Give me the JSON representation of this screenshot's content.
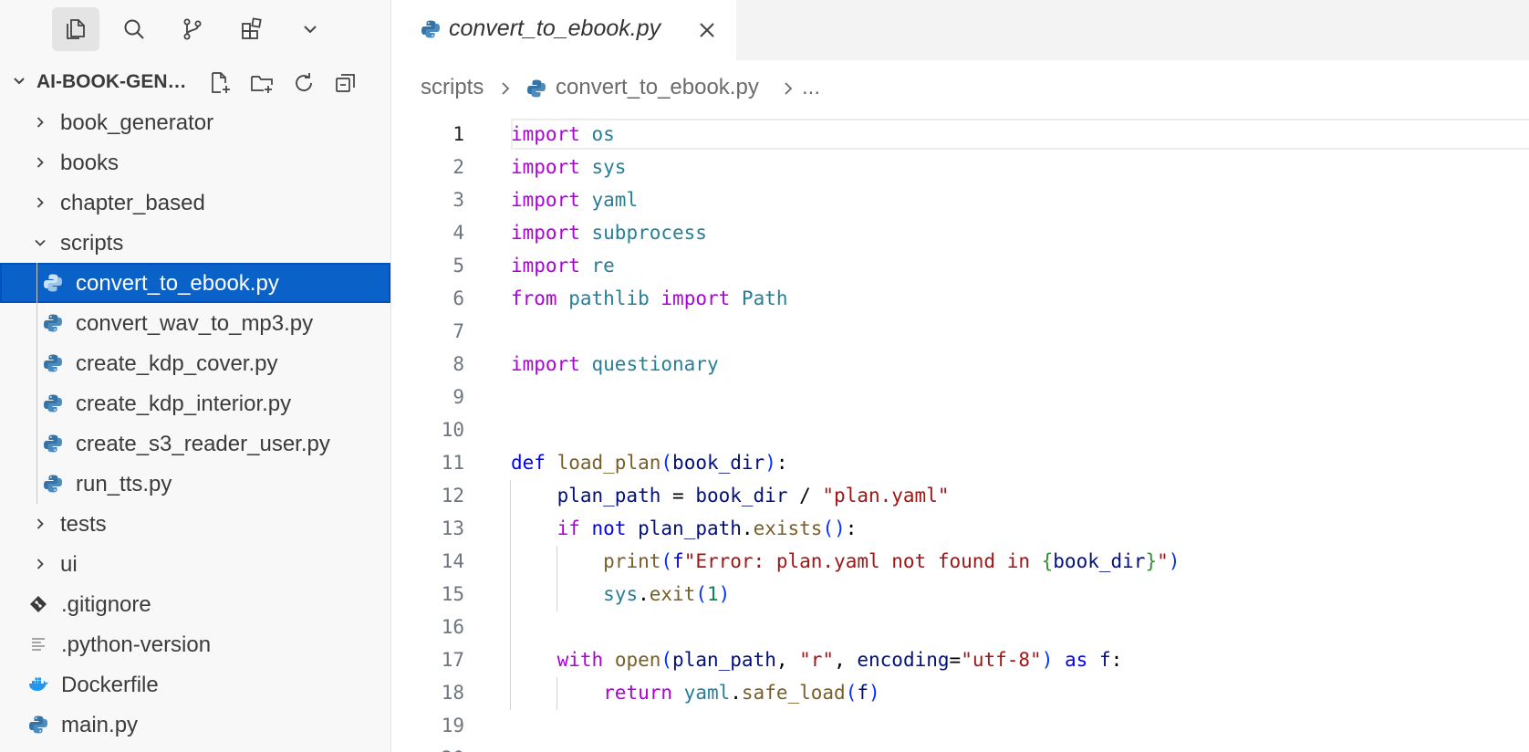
{
  "activity_bar": {
    "items": [
      {
        "name": "explorer-icon",
        "active": true
      },
      {
        "name": "search-icon",
        "active": false
      },
      {
        "name": "source-control-icon",
        "active": false
      },
      {
        "name": "extensions-icon",
        "active": false
      },
      {
        "name": "chevron-down-icon",
        "active": false
      }
    ]
  },
  "explorer": {
    "title": "AI-BOOK-GENERATOR",
    "actions": [
      "new-file-icon",
      "new-folder-icon",
      "refresh-icon",
      "collapse-all-icon"
    ],
    "tree": [
      {
        "label": "book_generator",
        "type": "folder",
        "expanded": false,
        "depth": 1
      },
      {
        "label": "books",
        "type": "folder",
        "expanded": false,
        "depth": 1
      },
      {
        "label": "chapter_based",
        "type": "folder",
        "expanded": false,
        "depth": 1
      },
      {
        "label": "scripts",
        "type": "folder",
        "expanded": true,
        "depth": 1
      },
      {
        "label": "convert_to_ebook.py",
        "type": "python",
        "depth": 2,
        "selected": true
      },
      {
        "label": "convert_wav_to_mp3.py",
        "type": "python",
        "depth": 2
      },
      {
        "label": "create_kdp_cover.py",
        "type": "python",
        "depth": 2
      },
      {
        "label": "create_kdp_interior.py",
        "type": "python",
        "depth": 2
      },
      {
        "label": "create_s3_reader_user.py",
        "type": "python",
        "depth": 2
      },
      {
        "label": "run_tts.py",
        "type": "python",
        "depth": 2
      },
      {
        "label": "tests",
        "type": "folder",
        "expanded": false,
        "depth": 1
      },
      {
        "label": "ui",
        "type": "folder",
        "expanded": false,
        "depth": 1
      },
      {
        "label": ".gitignore",
        "type": "git",
        "depth": 1
      },
      {
        "label": ".python-version",
        "type": "text",
        "depth": 1
      },
      {
        "label": "Dockerfile",
        "type": "docker",
        "depth": 1
      },
      {
        "label": "main.py",
        "type": "python",
        "depth": 1
      }
    ]
  },
  "editor": {
    "tab": {
      "label": "convert_to_ebook.py"
    },
    "breadcrumb": {
      "folder": "scripts",
      "file": "convert_to_ebook.py",
      "more": "..."
    },
    "current_line": 1,
    "lines": [
      [
        [
          "kw",
          "import"
        ],
        [
          "t",
          " "
        ],
        [
          "mod",
          "os"
        ]
      ],
      [
        [
          "kw",
          "import"
        ],
        [
          "t",
          " "
        ],
        [
          "mod",
          "sys"
        ]
      ],
      [
        [
          "kw",
          "import"
        ],
        [
          "t",
          " "
        ],
        [
          "mod",
          "yaml"
        ]
      ],
      [
        [
          "kw",
          "import"
        ],
        [
          "t",
          " "
        ],
        [
          "mod",
          "subprocess"
        ]
      ],
      [
        [
          "kw",
          "import"
        ],
        [
          "t",
          " "
        ],
        [
          "mod",
          "re"
        ]
      ],
      [
        [
          "kw",
          "from"
        ],
        [
          "t",
          " "
        ],
        [
          "mod",
          "pathlib"
        ],
        [
          "t",
          " "
        ],
        [
          "kw",
          "import"
        ],
        [
          "t",
          " "
        ],
        [
          "mod",
          "Path"
        ]
      ],
      [],
      [
        [
          "kw",
          "import"
        ],
        [
          "t",
          " "
        ],
        [
          "mod",
          "questionary"
        ]
      ],
      [],
      [],
      [
        [
          "def",
          "def"
        ],
        [
          "t",
          " "
        ],
        [
          "fn",
          "load_plan"
        ],
        [
          "brk1",
          "("
        ],
        [
          "var",
          "book_dir"
        ],
        [
          "brk1",
          ")"
        ],
        [
          "t",
          ":"
        ]
      ],
      [
        [
          "t",
          "    "
        ],
        [
          "var",
          "plan_path"
        ],
        [
          "t",
          " = "
        ],
        [
          "var",
          "book_dir"
        ],
        [
          "t",
          " / "
        ],
        [
          "str",
          "\"plan.yaml\""
        ]
      ],
      [
        [
          "t",
          "    "
        ],
        [
          "kw",
          "if"
        ],
        [
          "t",
          " "
        ],
        [
          "def",
          "not"
        ],
        [
          "t",
          " "
        ],
        [
          "var",
          "plan_path"
        ],
        [
          "t",
          "."
        ],
        [
          "fn",
          "exists"
        ],
        [
          "brk1",
          "()"
        ],
        [
          "t",
          ":"
        ]
      ],
      [
        [
          "t",
          "        "
        ],
        [
          "fn",
          "print"
        ],
        [
          "brk1",
          "("
        ],
        [
          "def",
          "f"
        ],
        [
          "str",
          "\"Error: plan.yaml not found in "
        ],
        [
          "brk2",
          "{"
        ],
        [
          "var",
          "book_dir"
        ],
        [
          "brk2",
          "}"
        ],
        [
          "str",
          "\""
        ],
        [
          "brk1",
          ")"
        ]
      ],
      [
        [
          "t",
          "        "
        ],
        [
          "mod",
          "sys"
        ],
        [
          "t",
          "."
        ],
        [
          "fn",
          "exit"
        ],
        [
          "brk1",
          "("
        ],
        [
          "num",
          "1"
        ],
        [
          "brk1",
          ")"
        ]
      ],
      [],
      [
        [
          "t",
          "    "
        ],
        [
          "kw",
          "with"
        ],
        [
          "t",
          " "
        ],
        [
          "fn",
          "open"
        ],
        [
          "brk1",
          "("
        ],
        [
          "var",
          "plan_path"
        ],
        [
          "t",
          ", "
        ],
        [
          "str",
          "\"r\""
        ],
        [
          "t",
          ", "
        ],
        [
          "var",
          "encoding"
        ],
        [
          "t",
          "="
        ],
        [
          "str",
          "\"utf-8\""
        ],
        [
          "brk1",
          ")"
        ],
        [
          "t",
          " "
        ],
        [
          "def",
          "as"
        ],
        [
          "t",
          " "
        ],
        [
          "var",
          "f"
        ],
        [
          "t",
          ":"
        ]
      ],
      [
        [
          "t",
          "        "
        ],
        [
          "kw",
          "return"
        ],
        [
          "t",
          " "
        ],
        [
          "mod",
          "yaml"
        ],
        [
          "t",
          "."
        ],
        [
          "fn",
          "safe_load"
        ],
        [
          "brk1",
          "("
        ],
        [
          "var",
          "f"
        ],
        [
          "brk1",
          ")"
        ]
      ],
      [],
      []
    ]
  }
}
